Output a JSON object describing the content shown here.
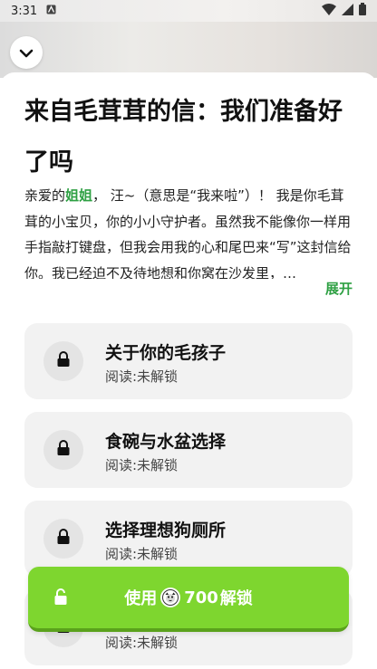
{
  "status": {
    "time": "3:31"
  },
  "letter": {
    "title": "来自毛茸茸的信：我们准备好了吗",
    "intro_before": "亲爱的",
    "intro_highlight": "姐姐",
    "intro_after": "， 汪~（意思是“我来啦”）！ 我是你毛茸茸的小宝贝，你的小小守护者。虽然我不能像你一样用手指敲打键盘，但我会用我的心和尾巴来“写”这封信给你。我已经迫不及待地想和你窝在沙发里，…",
    "expand_label": "展开"
  },
  "chapters": [
    {
      "title": "关于你的毛孩子",
      "status": "阅读:未解锁"
    },
    {
      "title": "食碗与水盆选择",
      "status": "阅读:未解锁"
    },
    {
      "title": "选择理想狗厕所",
      "status": "阅读:未解锁"
    },
    {
      "title": "",
      "status": "阅读:未解锁"
    }
  ],
  "unlock": {
    "prefix": "使用",
    "amount": "700",
    "suffix": "解锁"
  },
  "colors": {
    "accent_green": "#7ed62f",
    "highlight_green": "#2ea043"
  }
}
